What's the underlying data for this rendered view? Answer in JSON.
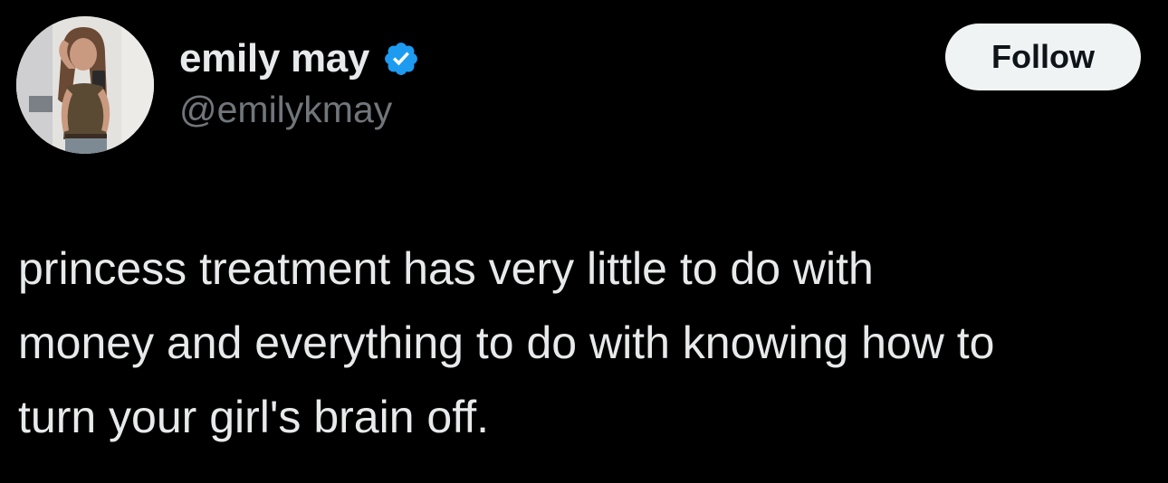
{
  "author": {
    "display_name": "emily may",
    "handle": "@emilykmay",
    "verified": true,
    "avatar_icon": "avatar-photo"
  },
  "actions": {
    "follow_label": "Follow"
  },
  "tweet": {
    "text": "princess treatment has very little to do with\nmoney and everything to do with knowing how to\nturn your girl's brain off."
  },
  "colors": {
    "background": "#000000",
    "primary_text": "#e7e9ea",
    "secondary_text": "#71767b",
    "verified_badge": "#1d9bf0",
    "follow_button_bg": "#eff3f4"
  }
}
